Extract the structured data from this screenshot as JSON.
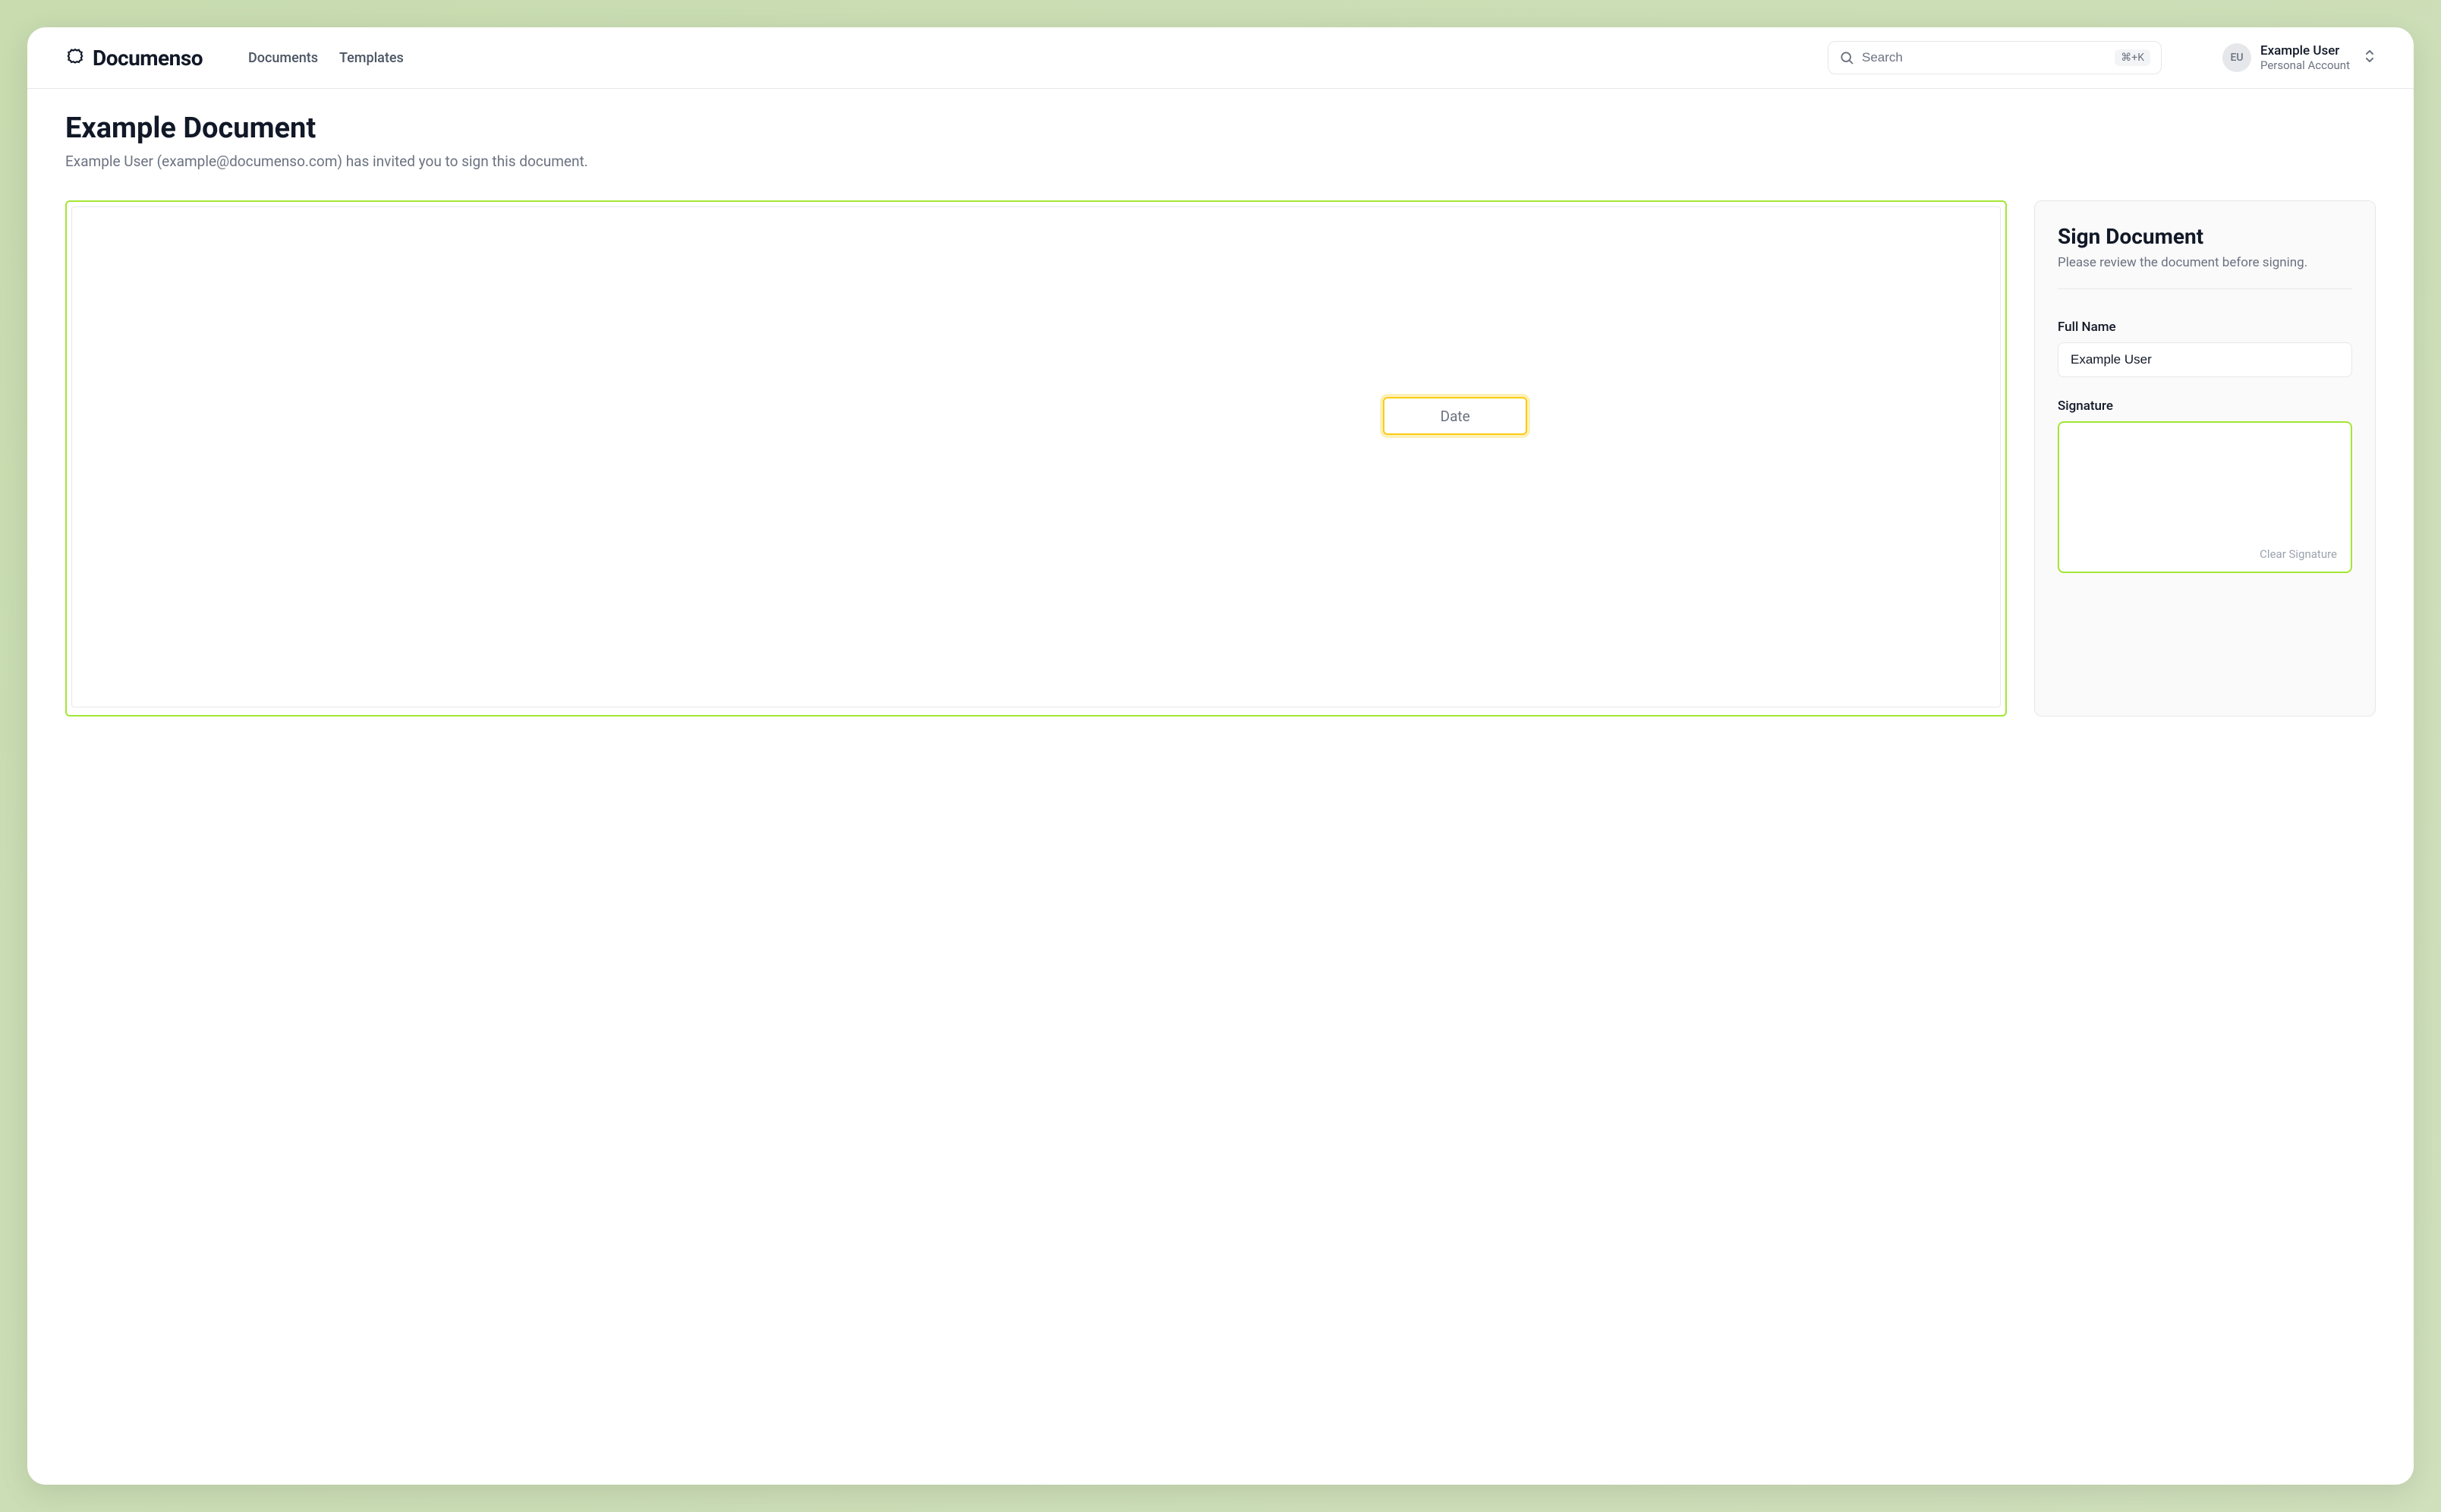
{
  "brand": {
    "name": "Documenso"
  },
  "nav": {
    "documents": "Documents",
    "templates": "Templates"
  },
  "search": {
    "placeholder": "Search",
    "shortcut": "⌘+K"
  },
  "account": {
    "initials": "EU",
    "name": "Example User",
    "type": "Personal Account"
  },
  "page": {
    "title": "Example Document",
    "subtitle": "Example User (example@documenso.com) has invited you to sign this document."
  },
  "document": {
    "fields": {
      "date_label": "Date"
    }
  },
  "sidebar": {
    "title": "Sign Document",
    "subtitle": "Please review the document before signing.",
    "full_name_label": "Full Name",
    "full_name_value": "Example User",
    "signature_label": "Signature",
    "clear_signature": "Clear Signature"
  }
}
